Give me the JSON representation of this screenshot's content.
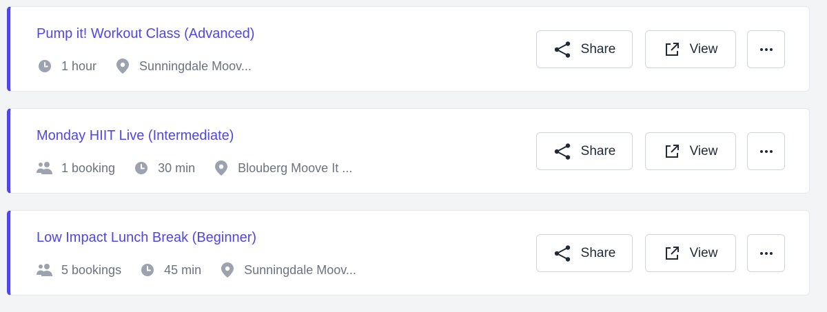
{
  "icons": {
    "duration": "clock-icon",
    "location": "map-pin-icon",
    "bookings": "users-icon",
    "share": "share-icon",
    "view": "external-link-icon",
    "more": "ellipsis-icon"
  },
  "colors": {
    "accent": "#4f46e5",
    "muted_text": "#6b7280",
    "meta_icon": "#9ca3af"
  },
  "buttons": {
    "share_label": "Share",
    "view_label": "View"
  },
  "classes": [
    {
      "title": "Pump it! Workout Class (Advanced)",
      "bookings": null,
      "duration": "1 hour",
      "location": "Sunningdale Moov..."
    },
    {
      "title": "Monday HIIT Live (Intermediate)",
      "bookings": "1 booking",
      "duration": "30 min",
      "location": "Blouberg Moove It ..."
    },
    {
      "title": "Low Impact Lunch Break (Beginner)",
      "bookings": "5 bookings",
      "duration": "45 min",
      "location": "Sunningdale Moov..."
    }
  ]
}
